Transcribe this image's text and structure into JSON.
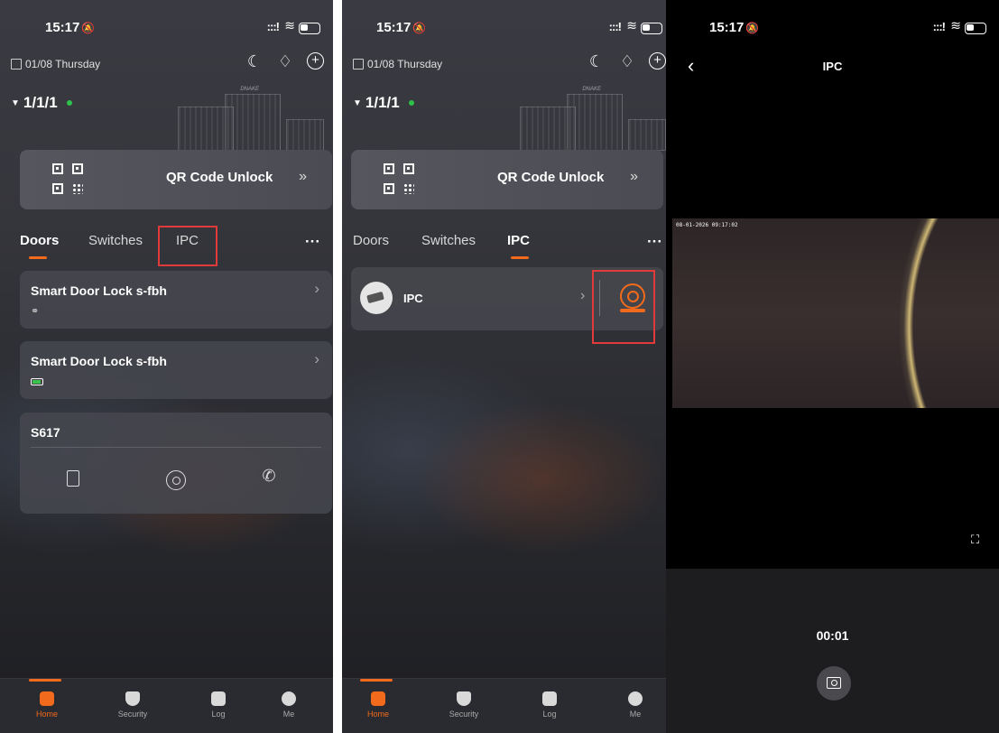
{
  "status": {
    "time": "15:17",
    "mute_icon": "bell-slash-icon",
    "signal": ":::!",
    "wifi_icon": "wifi-icon",
    "battery_icon": "battery-icon"
  },
  "screen1": {
    "date": "01/08 Thursday",
    "home_name": "1/1/1",
    "brand": "DNAKE",
    "qr_label": "QR Code Unlock",
    "qr_chevron": "»",
    "tabs": [
      "Doors",
      "Switches",
      "IPC"
    ],
    "more": "···",
    "cards": [
      {
        "title": "Smart Door Lock s-fbh",
        "chevron": "›",
        "sub_icon": "unlink-icon"
      },
      {
        "title": "Smart Door Lock s-fbh",
        "chevron": "›",
        "sub_icon": "battery-green-icon"
      },
      {
        "title": "S617",
        "actions": [
          "door-icon",
          "camera-icon",
          "phone-call-icon"
        ]
      }
    ],
    "tabbar": [
      "Home",
      "Security",
      "Log",
      "Me"
    ],
    "active_tab": "Home",
    "accent": "#f26a1b",
    "highlight": "#e03a3a"
  },
  "screen2": {
    "date": "01/08 Thursday",
    "home_name": "1/1/1",
    "brand": "DNAKE",
    "qr_label": "QR Code Unlock",
    "qr_chevron": "»",
    "tabs": [
      "Doors",
      "Switches",
      "IPC"
    ],
    "more": "···",
    "ipc_item": {
      "label": "IPC",
      "chevron": "›"
    },
    "tabbar": [
      "Home",
      "Security",
      "Log",
      "Me"
    ]
  },
  "screen3": {
    "title": "IPC",
    "back": "‹",
    "osd": "08-01-2026 09:17:02",
    "timer": "00:01",
    "fullscreen_icon": "fullscreen-icon",
    "snapshot_icon": "camera-snapshot-icon"
  }
}
